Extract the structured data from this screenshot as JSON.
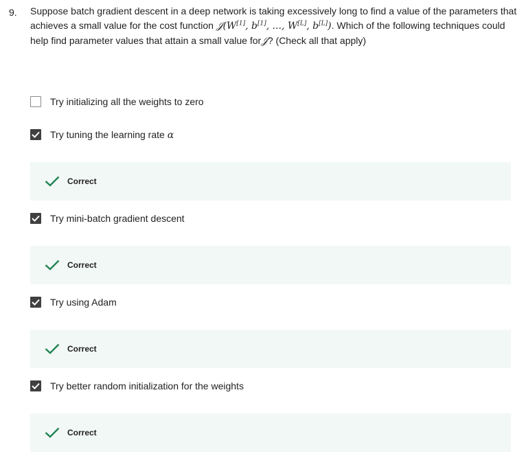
{
  "question": {
    "number": "9.",
    "text_1": "Suppose batch gradient descent in a deep network is taking excessively long to find a value of the parameters that achieves a small value for the cost function ",
    "math_cost": "𝒥(W",
    "sup_1": "[1]",
    "math_b": ", b",
    "sup_2": "[1]",
    "math_dots": ", ..., W",
    "sup_3": "[L]",
    "math_b2": ", b",
    "sup_4": "[L]",
    "math_close": ")",
    "text_2": ". Which of the following techniques could help find parameter values that attain a small value for",
    "math_j": "𝒥",
    "text_3": "? (Check all that apply)"
  },
  "options": [
    {
      "label": "Try initializing all the weights to zero",
      "checked": false
    },
    {
      "label": "Try tuning the learning rate ",
      "math": "α",
      "checked": true
    },
    {
      "label": "Try mini-batch gradient descent",
      "checked": true
    },
    {
      "label": "Try using Adam",
      "checked": true
    },
    {
      "label": "Try better random initialization for the weights",
      "checked": true
    }
  ],
  "feedback": [
    {
      "text": "Correct"
    },
    {
      "text": "Correct"
    },
    {
      "text": "Correct"
    },
    {
      "text": "Correct"
    }
  ],
  "colors": {
    "check_green": "#1f8354",
    "feedback_bg": "#f2f8f5",
    "checkbox_fill": "#404040"
  }
}
